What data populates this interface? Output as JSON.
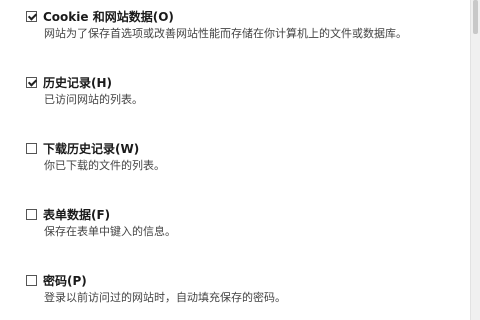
{
  "options": [
    {
      "checked": true,
      "title": "Cookie 和网站数据(O)",
      "description": "网站为了保存首选项或改善网站性能而存储在你计算机上的文件或数据库。"
    },
    {
      "checked": true,
      "title": "历史记录(H)",
      "description": "已访问网站的列表。"
    },
    {
      "checked": false,
      "title": "下载历史记录(W)",
      "description": "你已下载的文件的列表。"
    },
    {
      "checked": false,
      "title": "表单数据(F)",
      "description": "保存在表单中键入的信息。"
    },
    {
      "checked": false,
      "title": "密码(P)",
      "description": "登录以前访问过的网站时，自动填充保存的密码。"
    }
  ]
}
